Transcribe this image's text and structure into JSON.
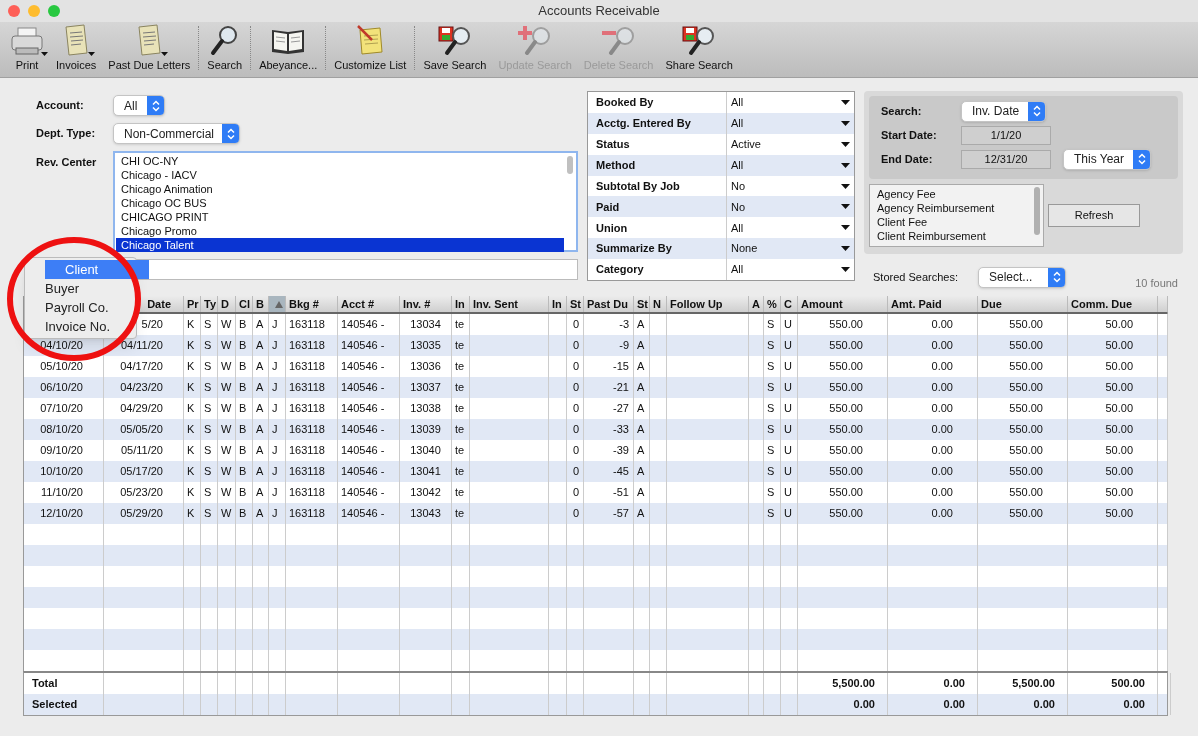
{
  "window": {
    "title": "Accounts Receivable"
  },
  "toolbar": [
    [
      {
        "label": "Print",
        "kind": "printer",
        "menu": true,
        "disabled": false
      },
      {
        "label": "Invoices",
        "kind": "document",
        "menu": true,
        "disabled": false
      },
      {
        "label": "Past Due Letters",
        "kind": "document",
        "menu": true,
        "disabled": false
      }
    ],
    [
      {
        "label": "Search",
        "kind": "search",
        "menu": false,
        "disabled": false
      }
    ],
    [
      {
        "label": "Abeyance...",
        "kind": "book",
        "menu": false,
        "disabled": false
      }
    ],
    [
      {
        "label": "Customize List",
        "kind": "notepad",
        "menu": false,
        "disabled": false
      }
    ],
    [
      {
        "label": "Save Search",
        "kind": "save",
        "menu": false,
        "disabled": false
      },
      {
        "label": "Update Search",
        "kind": "add",
        "menu": false,
        "disabled": true
      },
      {
        "label": "Delete Search",
        "kind": "remove",
        "menu": false,
        "disabled": true
      },
      {
        "label": "Share Search",
        "kind": "save",
        "menu": false,
        "disabled": false
      }
    ]
  ],
  "form": {
    "account": {
      "label": "Account:",
      "value": "All"
    },
    "dept_type": {
      "label": "Dept. Type:",
      "value": "Non-Commercial"
    },
    "rev_center": {
      "label": "Rev. Center",
      "items": [
        {
          "text": "CHI OC-NY",
          "selected": false
        },
        {
          "text": "Chicago - IACV",
          "selected": false
        },
        {
          "text": "Chicago Animation",
          "selected": false
        },
        {
          "text": "Chicago OC BUS",
          "selected": false
        },
        {
          "text": "CHICAGO PRINT",
          "selected": false
        },
        {
          "text": "Chicago Promo",
          "selected": false
        },
        {
          "text": "Chicago Talent",
          "selected": true
        }
      ]
    }
  },
  "search_by_menu": [
    {
      "label": "Client",
      "selected": true
    },
    {
      "label": "Buyer",
      "selected": false
    },
    {
      "label": "Payroll Co.",
      "selected": false
    },
    {
      "label": "Invoice No.",
      "selected": false
    }
  ],
  "filters": [
    {
      "label": "Booked By",
      "value": "All"
    },
    {
      "label": "Acctg. Entered By",
      "value": "All"
    },
    {
      "label": "Status",
      "value": "Active"
    },
    {
      "label": "Method",
      "value": "All"
    },
    {
      "label": "Subtotal By Job",
      "value": "No"
    },
    {
      "label": "Paid",
      "value": "No"
    },
    {
      "label": "Union",
      "value": "All"
    },
    {
      "label": "Summarize By",
      "value": "None"
    },
    {
      "label": "Category",
      "value": "All"
    }
  ],
  "date_search": {
    "search_label": "Search:",
    "search_value": "Inv. Date",
    "start_label": "Start Date:",
    "start_value": "1/1/20",
    "end_label": "End Date:",
    "end_value": "12/31/20",
    "range_value": "This Year"
  },
  "categories": [
    "Agency Fee",
    "Agency Reimbursement",
    "Client Fee",
    "Client Reimbursement"
  ],
  "refresh_button": "Refresh",
  "stored_searches": {
    "label": "Stored Searches:",
    "value": "Select..."
  },
  "found_count": "10 found",
  "table": {
    "columns": [
      null,
      {
        "label": "Date",
        "sorted": false
      },
      {
        "label": "Pr",
        "sorted": false
      },
      {
        "label": "Ty",
        "sorted": false
      },
      {
        "label": "D",
        "sorted": false
      },
      {
        "label": "Cl",
        "sorted": false
      },
      {
        "label": "B",
        "sorted": false
      },
      {
        "sorted": true
      },
      {
        "label": "Bkg #",
        "sorted": false
      },
      {
        "label": "Acct #",
        "sorted": false
      },
      {
        "label": "Inv. #",
        "sorted": false
      },
      {
        "label": "In",
        "sorted": false
      },
      {
        "label": "Inv. Sent",
        "sorted": false
      },
      {
        "label": "In",
        "sorted": false
      },
      {
        "label": "St",
        "sorted": false
      },
      {
        "label": "Past Du",
        "sorted": false
      },
      {
        "label": "St",
        "sorted": false
      },
      {
        "label": "N",
        "sorted": false
      },
      {
        "label": "Follow Up",
        "sorted": false
      },
      {
        "label": "A",
        "sorted": false
      },
      {
        "label": "%",
        "sorted": false
      },
      {
        "label": "C",
        "sorted": false
      },
      {
        "label": "Amount",
        "sorted": false
      },
      {
        "label": "Amt. Paid",
        "sorted": false
      },
      {
        "label": "Due",
        "sorted": false
      },
      {
        "label": "Comm. Due",
        "sorted": false
      }
    ],
    "rows": [
      [
        null,
        "5/20",
        "K",
        "S",
        "W",
        "B",
        "A",
        "J",
        "163118",
        "140546 -",
        "13034",
        "te",
        null,
        null,
        "0",
        "-3",
        "A",
        null,
        null,
        null,
        "S",
        "U",
        "550.00",
        "0.00",
        "550.00",
        "50.00"
      ],
      [
        "04/10/20",
        "04/11/20",
        "K",
        "S",
        "W",
        "B",
        "A",
        "J",
        "163118",
        "140546 -",
        "13035",
        "te",
        null,
        null,
        "0",
        "-9",
        "A",
        null,
        null,
        null,
        "S",
        "U",
        "550.00",
        "0.00",
        "550.00",
        "50.00"
      ],
      [
        "05/10/20",
        "04/17/20",
        "K",
        "S",
        "W",
        "B",
        "A",
        "J",
        "163118",
        "140546 -",
        "13036",
        "te",
        null,
        null,
        "0",
        "-15",
        "A",
        null,
        null,
        null,
        "S",
        "U",
        "550.00",
        "0.00",
        "550.00",
        "50.00"
      ],
      [
        "06/10/20",
        "04/23/20",
        "K",
        "S",
        "W",
        "B",
        "A",
        "J",
        "163118",
        "140546 -",
        "13037",
        "te",
        null,
        null,
        "0",
        "-21",
        "A",
        null,
        null,
        null,
        "S",
        "U",
        "550.00",
        "0.00",
        "550.00",
        "50.00"
      ],
      [
        "07/10/20",
        "04/29/20",
        "K",
        "S",
        "W",
        "B",
        "A",
        "J",
        "163118",
        "140546 -",
        "13038",
        "te",
        null,
        null,
        "0",
        "-27",
        "A",
        null,
        null,
        null,
        "S",
        "U",
        "550.00",
        "0.00",
        "550.00",
        "50.00"
      ],
      [
        "08/10/20",
        "05/05/20",
        "K",
        "S",
        "W",
        "B",
        "A",
        "J",
        "163118",
        "140546 -",
        "13039",
        "te",
        null,
        null,
        "0",
        "-33",
        "A",
        null,
        null,
        null,
        "S",
        "U",
        "550.00",
        "0.00",
        "550.00",
        "50.00"
      ],
      [
        "09/10/20",
        "05/11/20",
        "K",
        "S",
        "W",
        "B",
        "A",
        "J",
        "163118",
        "140546 -",
        "13040",
        "te",
        null,
        null,
        "0",
        "-39",
        "A",
        null,
        null,
        null,
        "S",
        "U",
        "550.00",
        "0.00",
        "550.00",
        "50.00"
      ],
      [
        "10/10/20",
        "05/17/20",
        "K",
        "S",
        "W",
        "B",
        "A",
        "J",
        "163118",
        "140546 -",
        "13041",
        "te",
        null,
        null,
        "0",
        "-45",
        "A",
        null,
        null,
        null,
        "S",
        "U",
        "550.00",
        "0.00",
        "550.00",
        "50.00"
      ],
      [
        "11/10/20",
        "05/23/20",
        "K",
        "S",
        "W",
        "B",
        "A",
        "J",
        "163118",
        "140546 -",
        "13042",
        "te",
        null,
        null,
        "0",
        "-51",
        "A",
        null,
        null,
        null,
        "S",
        "U",
        "550.00",
        "0.00",
        "550.00",
        "50.00"
      ],
      [
        "12/10/20",
        "05/29/20",
        "K",
        "S",
        "W",
        "B",
        "A",
        "J",
        "163118",
        "140546 -",
        "13043",
        "te",
        null,
        null,
        "0",
        "-57",
        "A",
        null,
        null,
        null,
        "S",
        "U",
        "550.00",
        "0.00",
        "550.00",
        "50.00"
      ]
    ],
    "footer": [
      {
        "label": "Total",
        "values": [
          "5,500.00",
          "0.00",
          "5,500.00",
          "500.00"
        ]
      },
      {
        "label": "Selected",
        "values": [
          "0.00",
          "0.00",
          "0.00",
          "0.00"
        ]
      }
    ]
  }
}
